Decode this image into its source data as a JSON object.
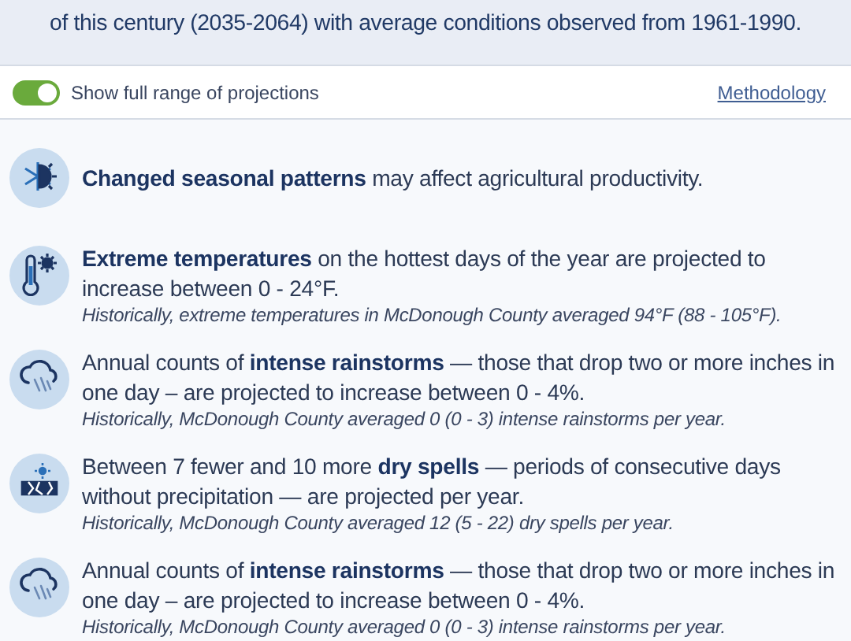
{
  "intro": {
    "text": "of this century (2035-2064) with average conditions observed from 1961-1990."
  },
  "toggle": {
    "label": "Show full range of projections",
    "on": true
  },
  "methodology_link": "Methodology",
  "impacts": [
    {
      "kind": "seasons",
      "text": "**Changed seasonal patterns** may affect agricultural productivity."
    },
    {
      "kind": "heat",
      "text": "**Extreme temperatures** on the hottest days of the year are projected to increase between 0 - 24°F.",
      "history": "Historically, extreme temperatures in McDonough County averaged 94°F (88 - 105°F)."
    },
    {
      "kind": "rain",
      "text": "Annual counts of **intense rainstorms** — those that drop two or more inches in one day – are projected to increase between 0 - 4%.",
      "history": "Historically, McDonough County averaged 0 (0 - 3) intense rainstorms per year."
    },
    {
      "kind": "drought",
      "text": "Between 7 fewer and 10 more **dry spells** — periods of consecutive days without precipitation — are projected per year.",
      "history": "Historically, McDonough County averaged 12 (5 - 22) dry spells per year."
    },
    {
      "kind": "rain",
      "text": "Annual counts of **intense rainstorms** — those that drop two or more inches in one day – are projected to increase between 0 - 4%.",
      "history": "Historically, McDonough County averaged 0 (0 - 3) intense rainstorms per year."
    }
  ]
}
